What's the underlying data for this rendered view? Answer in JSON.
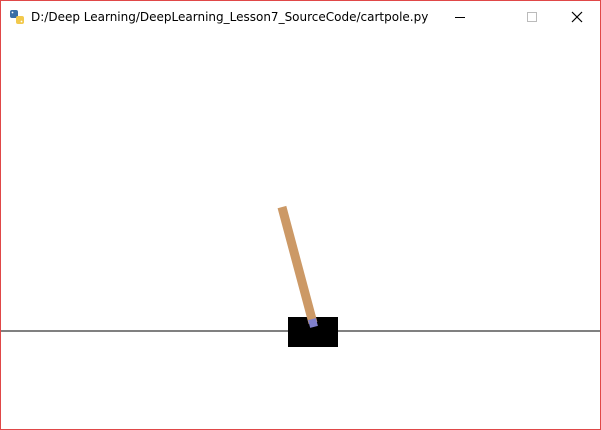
{
  "window": {
    "title": "D:/Deep Learning/DeepLearning_Lesson7_SourceCode/cartpole.py",
    "icon": "python-icon",
    "controls": {
      "minimize": "minimize-icon",
      "maximize": "maximize-icon",
      "close": "close-icon"
    }
  },
  "scene": {
    "pole_angle_deg": -15,
    "colors": {
      "background": "#ffffff",
      "track": "#000000",
      "cart": "#000000",
      "pole": "#cc9966",
      "axle": "#8080cc",
      "border": "#e04848"
    }
  }
}
